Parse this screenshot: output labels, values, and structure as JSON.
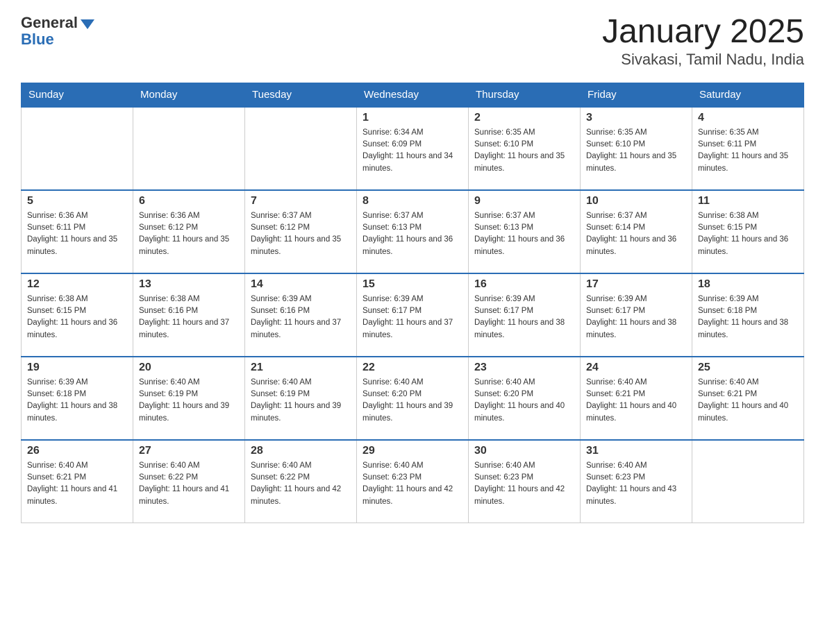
{
  "logo": {
    "general": "General",
    "blue": "Blue"
  },
  "title": "January 2025",
  "subtitle": "Sivakasi, Tamil Nadu, India",
  "days_of_week": [
    "Sunday",
    "Monday",
    "Tuesday",
    "Wednesday",
    "Thursday",
    "Friday",
    "Saturday"
  ],
  "weeks": [
    [
      {
        "day": "",
        "info": ""
      },
      {
        "day": "",
        "info": ""
      },
      {
        "day": "",
        "info": ""
      },
      {
        "day": "1",
        "info": "Sunrise: 6:34 AM\nSunset: 6:09 PM\nDaylight: 11 hours and 34 minutes."
      },
      {
        "day": "2",
        "info": "Sunrise: 6:35 AM\nSunset: 6:10 PM\nDaylight: 11 hours and 35 minutes."
      },
      {
        "day": "3",
        "info": "Sunrise: 6:35 AM\nSunset: 6:10 PM\nDaylight: 11 hours and 35 minutes."
      },
      {
        "day": "4",
        "info": "Sunrise: 6:35 AM\nSunset: 6:11 PM\nDaylight: 11 hours and 35 minutes."
      }
    ],
    [
      {
        "day": "5",
        "info": "Sunrise: 6:36 AM\nSunset: 6:11 PM\nDaylight: 11 hours and 35 minutes."
      },
      {
        "day": "6",
        "info": "Sunrise: 6:36 AM\nSunset: 6:12 PM\nDaylight: 11 hours and 35 minutes."
      },
      {
        "day": "7",
        "info": "Sunrise: 6:37 AM\nSunset: 6:12 PM\nDaylight: 11 hours and 35 minutes."
      },
      {
        "day": "8",
        "info": "Sunrise: 6:37 AM\nSunset: 6:13 PM\nDaylight: 11 hours and 36 minutes."
      },
      {
        "day": "9",
        "info": "Sunrise: 6:37 AM\nSunset: 6:13 PM\nDaylight: 11 hours and 36 minutes."
      },
      {
        "day": "10",
        "info": "Sunrise: 6:37 AM\nSunset: 6:14 PM\nDaylight: 11 hours and 36 minutes."
      },
      {
        "day": "11",
        "info": "Sunrise: 6:38 AM\nSunset: 6:15 PM\nDaylight: 11 hours and 36 minutes."
      }
    ],
    [
      {
        "day": "12",
        "info": "Sunrise: 6:38 AM\nSunset: 6:15 PM\nDaylight: 11 hours and 36 minutes."
      },
      {
        "day": "13",
        "info": "Sunrise: 6:38 AM\nSunset: 6:16 PM\nDaylight: 11 hours and 37 minutes."
      },
      {
        "day": "14",
        "info": "Sunrise: 6:39 AM\nSunset: 6:16 PM\nDaylight: 11 hours and 37 minutes."
      },
      {
        "day": "15",
        "info": "Sunrise: 6:39 AM\nSunset: 6:17 PM\nDaylight: 11 hours and 37 minutes."
      },
      {
        "day": "16",
        "info": "Sunrise: 6:39 AM\nSunset: 6:17 PM\nDaylight: 11 hours and 38 minutes."
      },
      {
        "day": "17",
        "info": "Sunrise: 6:39 AM\nSunset: 6:17 PM\nDaylight: 11 hours and 38 minutes."
      },
      {
        "day": "18",
        "info": "Sunrise: 6:39 AM\nSunset: 6:18 PM\nDaylight: 11 hours and 38 minutes."
      }
    ],
    [
      {
        "day": "19",
        "info": "Sunrise: 6:39 AM\nSunset: 6:18 PM\nDaylight: 11 hours and 38 minutes."
      },
      {
        "day": "20",
        "info": "Sunrise: 6:40 AM\nSunset: 6:19 PM\nDaylight: 11 hours and 39 minutes."
      },
      {
        "day": "21",
        "info": "Sunrise: 6:40 AM\nSunset: 6:19 PM\nDaylight: 11 hours and 39 minutes."
      },
      {
        "day": "22",
        "info": "Sunrise: 6:40 AM\nSunset: 6:20 PM\nDaylight: 11 hours and 39 minutes."
      },
      {
        "day": "23",
        "info": "Sunrise: 6:40 AM\nSunset: 6:20 PM\nDaylight: 11 hours and 40 minutes."
      },
      {
        "day": "24",
        "info": "Sunrise: 6:40 AM\nSunset: 6:21 PM\nDaylight: 11 hours and 40 minutes."
      },
      {
        "day": "25",
        "info": "Sunrise: 6:40 AM\nSunset: 6:21 PM\nDaylight: 11 hours and 40 minutes."
      }
    ],
    [
      {
        "day": "26",
        "info": "Sunrise: 6:40 AM\nSunset: 6:21 PM\nDaylight: 11 hours and 41 minutes."
      },
      {
        "day": "27",
        "info": "Sunrise: 6:40 AM\nSunset: 6:22 PM\nDaylight: 11 hours and 41 minutes."
      },
      {
        "day": "28",
        "info": "Sunrise: 6:40 AM\nSunset: 6:22 PM\nDaylight: 11 hours and 42 minutes."
      },
      {
        "day": "29",
        "info": "Sunrise: 6:40 AM\nSunset: 6:23 PM\nDaylight: 11 hours and 42 minutes."
      },
      {
        "day": "30",
        "info": "Sunrise: 6:40 AM\nSunset: 6:23 PM\nDaylight: 11 hours and 42 minutes."
      },
      {
        "day": "31",
        "info": "Sunrise: 6:40 AM\nSunset: 6:23 PM\nDaylight: 11 hours and 43 minutes."
      },
      {
        "day": "",
        "info": ""
      }
    ]
  ]
}
